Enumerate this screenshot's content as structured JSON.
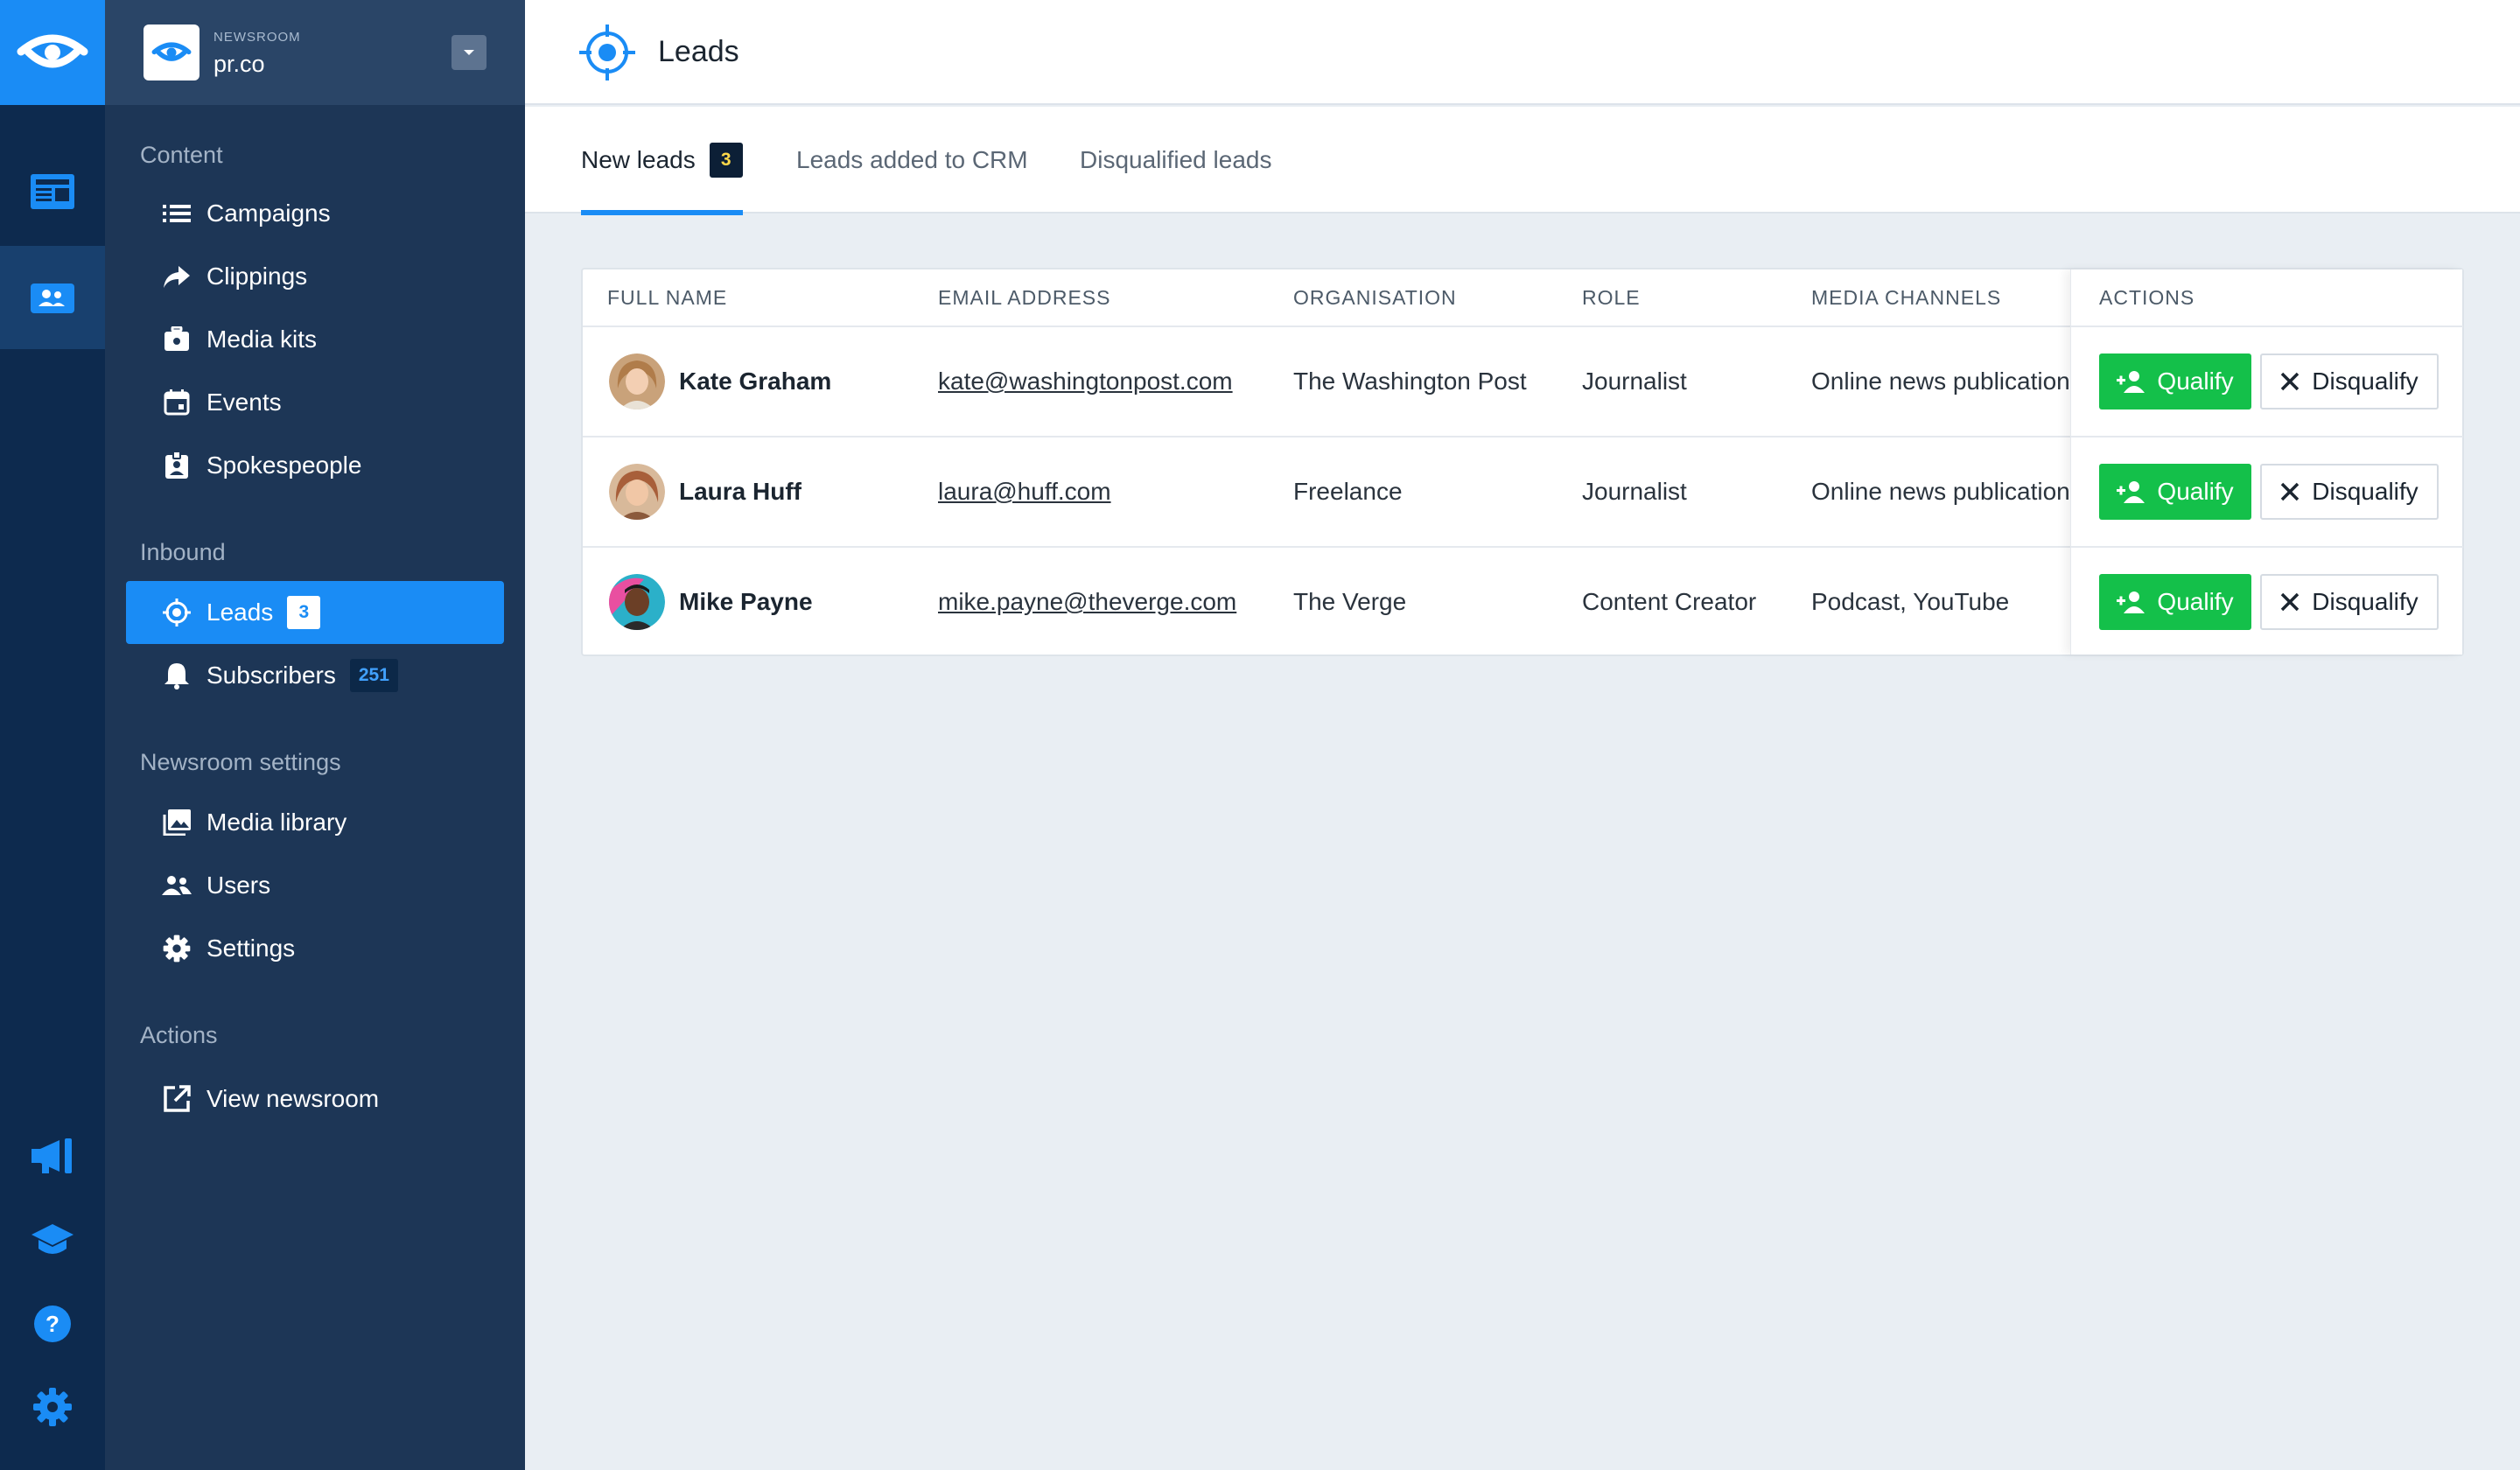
{
  "rail": {
    "items": [
      {
        "name": "logo-icon"
      },
      {
        "name": "newsroom-icon"
      },
      {
        "name": "contacts-icon",
        "active": true
      },
      {
        "name": "announcement-icon"
      },
      {
        "name": "learn-icon"
      },
      {
        "name": "help-icon"
      },
      {
        "name": "settings-gear-icon"
      }
    ]
  },
  "newsroom": {
    "kicker": "NEWSROOM",
    "name": "pr.co"
  },
  "sidebar": {
    "sections": [
      {
        "heading": "Content",
        "items": [
          {
            "label": "Campaigns",
            "icon": "list-icon"
          },
          {
            "label": "Clippings",
            "icon": "share-arrow-icon"
          },
          {
            "label": "Media kits",
            "icon": "briefcase-icon"
          },
          {
            "label": "Events",
            "icon": "calendar-icon"
          },
          {
            "label": "Spokespeople",
            "icon": "id-badge-icon"
          }
        ]
      },
      {
        "heading": "Inbound",
        "items": [
          {
            "label": "Leads",
            "icon": "target-icon",
            "badge": "3",
            "active": true
          },
          {
            "label": "Subscribers",
            "icon": "bell-icon",
            "badge": "251"
          }
        ]
      },
      {
        "heading": "Newsroom settings",
        "items": [
          {
            "label": "Media library",
            "icon": "image-icon"
          },
          {
            "label": "Users",
            "icon": "users-icon"
          },
          {
            "label": "Settings",
            "icon": "gear-icon"
          }
        ]
      },
      {
        "heading": "Actions",
        "items": [
          {
            "label": "View newsroom",
            "icon": "external-link-icon"
          }
        ]
      }
    ]
  },
  "page": {
    "title": "Leads"
  },
  "tabs": [
    {
      "label": "New leads",
      "badge": "3",
      "active": true
    },
    {
      "label": "Leads added to CRM"
    },
    {
      "label": "Disqualified leads"
    }
  ],
  "table": {
    "columns": [
      "FULL NAME",
      "EMAIL ADDRESS",
      "ORGANISATION",
      "ROLE",
      "MEDIA CHANNELS",
      "ACTIONS"
    ],
    "rows": [
      {
        "name": "Kate Graham",
        "email": "kate@washingtonpost.com",
        "organisation": "The Washington Post",
        "role": "Journalist",
        "channels": "Online news publication"
      },
      {
        "name": "Laura Huff",
        "email": "laura@huff.com",
        "organisation": "Freelance",
        "role": "Journalist",
        "channels": "Online news publication"
      },
      {
        "name": "Mike Payne",
        "email": "mike.payne@theverge.com",
        "organisation": "The Verge",
        "role": "Content Creator",
        "channels": "Podcast, YouTube"
      }
    ],
    "actions": {
      "qualify": "Qualify",
      "disqualify": "Disqualify"
    }
  },
  "colors": {
    "accent": "#1a8cf5",
    "qualify": "#14c04a",
    "rail": "#0d2a4e",
    "sidebar": "#1d3656"
  }
}
